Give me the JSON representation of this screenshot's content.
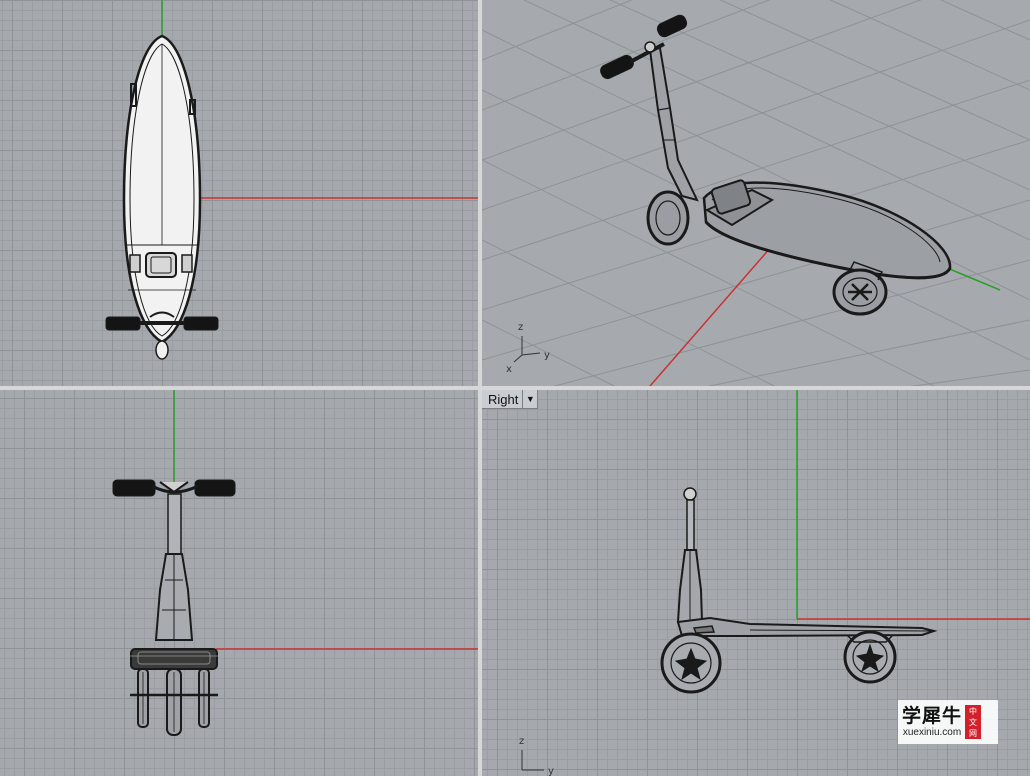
{
  "viewports": {
    "top": {
      "axis_labels": []
    },
    "perspective": {
      "axis_labels": {
        "z": "z",
        "y": "y",
        "x": "x"
      }
    },
    "front": {
      "axis_labels": []
    },
    "right": {
      "label": "Right",
      "dropdown_icon": "chevron-down-icon",
      "axis_labels": {
        "z": "z",
        "y": "y"
      }
    }
  },
  "colors": {
    "grid_background": "#a5a9ad",
    "x_axis": "#c83232",
    "y_axis": "#2aa02a",
    "wire": "#1a1a1a",
    "grip": "#141414"
  },
  "watermark": {
    "chinese": "学犀牛",
    "url": "xuexiniu.com",
    "seal_line1": "中",
    "seal_line2": "文",
    "seal_line3": "网"
  }
}
